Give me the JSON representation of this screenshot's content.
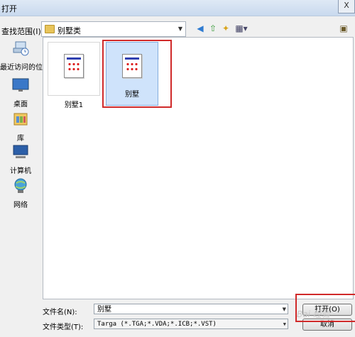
{
  "window": {
    "title": "打开",
    "close_label": "X"
  },
  "toolbar": {
    "look_in_label": "查找范围(I):",
    "look_in_value": "别墅类"
  },
  "places": [
    {
      "label": "最近访问的位置",
      "icon": "recent-places-icon"
    },
    {
      "label": "桌面",
      "icon": "desktop-icon"
    },
    {
      "label": "库",
      "icon": "library-icon"
    },
    {
      "label": "计算机",
      "icon": "computer-icon"
    },
    {
      "label": "网络",
      "icon": "network-icon"
    }
  ],
  "files": [
    {
      "name": "别墅1",
      "selected": false
    },
    {
      "name": "别墅",
      "selected": true
    }
  ],
  "bottom": {
    "filename_label": "文件名(N):",
    "filename_value": "别墅",
    "filetype_label": "文件类型(T):",
    "filetype_value": "Targa (*.TGA;*.VDA;*.ICB;*.VST)",
    "open_button": "打开(O)",
    "cancel_button": "取消"
  },
  "watermark": "Bai 经验"
}
